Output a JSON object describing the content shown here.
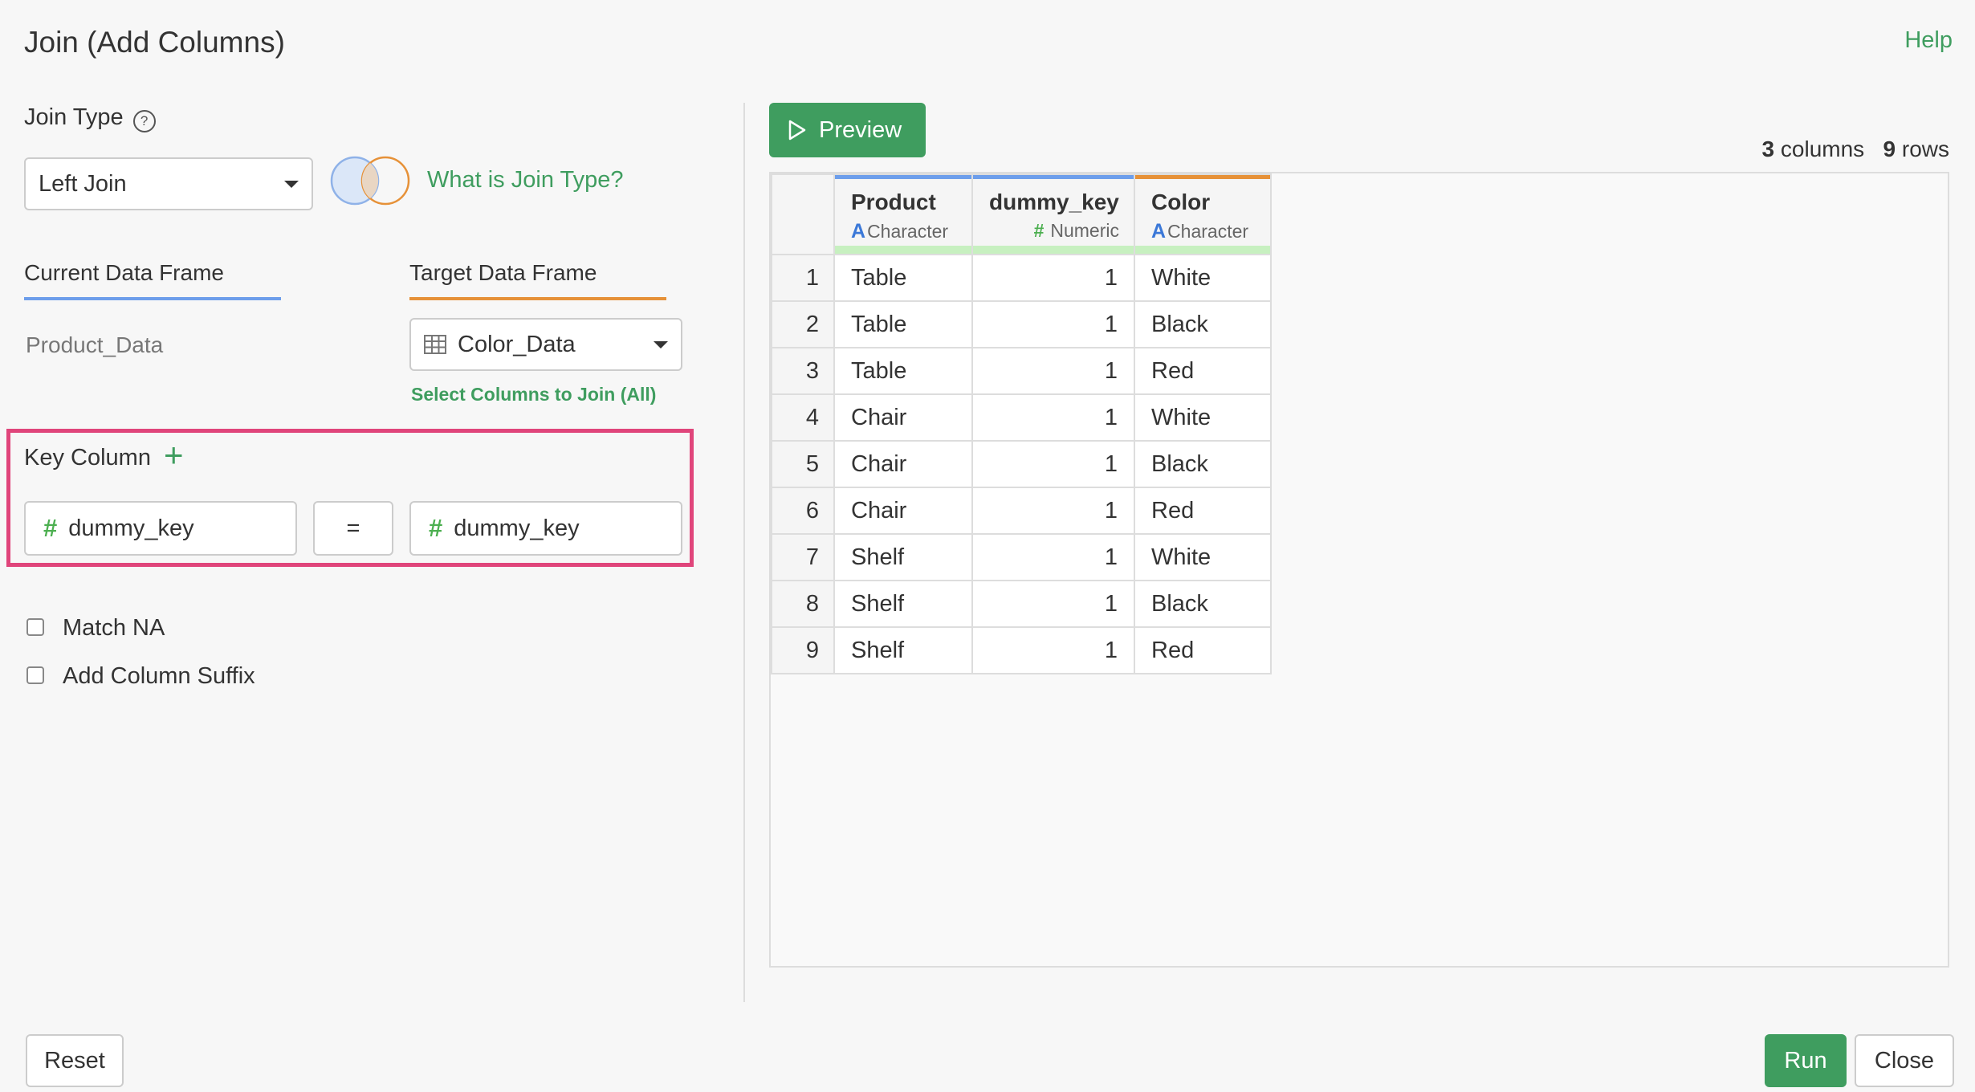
{
  "dialog": {
    "title": "Join (Add Columns)",
    "help_label": "Help"
  },
  "join_type": {
    "label": "Join Type",
    "help_icon": "?",
    "selected": "Left Join",
    "what_is_link": "What is Join Type?"
  },
  "frames": {
    "current_label": "Current Data Frame",
    "current_value": "Product_Data",
    "target_label": "Target Data Frame",
    "target_value": "Color_Data",
    "select_columns_link": "Select Columns to Join (All)"
  },
  "key_column": {
    "label": "Key Column",
    "add_icon": "+",
    "left_key": "dummy_key",
    "operator": "=",
    "right_key": "dummy_key",
    "highlight_color": "#e0457b"
  },
  "options": {
    "match_na": "Match NA",
    "match_na_checked": false,
    "add_suffix": "Add Column Suffix",
    "add_suffix_checked": false
  },
  "preview": {
    "button_label": "Preview",
    "columns_count": "3",
    "columns_label": "columns",
    "rows_count": "9",
    "rows_label": "rows",
    "headers": [
      {
        "name": "Product",
        "type": "Character",
        "type_icon": "A",
        "bar_color": "#6d9eeb"
      },
      {
        "name": "dummy_key",
        "type": "Numeric",
        "type_icon": "#",
        "bar_color": "#6d9eeb"
      },
      {
        "name": "Color",
        "type": "Character",
        "type_icon": "A",
        "bar_color": "#e69138"
      }
    ],
    "rows": [
      [
        "1",
        "Table",
        "1",
        "White"
      ],
      [
        "2",
        "Table",
        "1",
        "Black"
      ],
      [
        "3",
        "Table",
        "1",
        "Red"
      ],
      [
        "4",
        "Chair",
        "1",
        "White"
      ],
      [
        "5",
        "Chair",
        "1",
        "Black"
      ],
      [
        "6",
        "Chair",
        "1",
        "Red"
      ],
      [
        "7",
        "Shelf",
        "1",
        "White"
      ],
      [
        "8",
        "Shelf",
        "1",
        "Black"
      ],
      [
        "9",
        "Shelf",
        "1",
        "Red"
      ]
    ]
  },
  "footer": {
    "reset_label": "Reset",
    "run_label": "Run",
    "close_label": "Close"
  },
  "colors": {
    "accent_green": "#3f9d5f",
    "current_frame_underline": "#6d9eeb",
    "target_frame_underline": "#e69138"
  }
}
